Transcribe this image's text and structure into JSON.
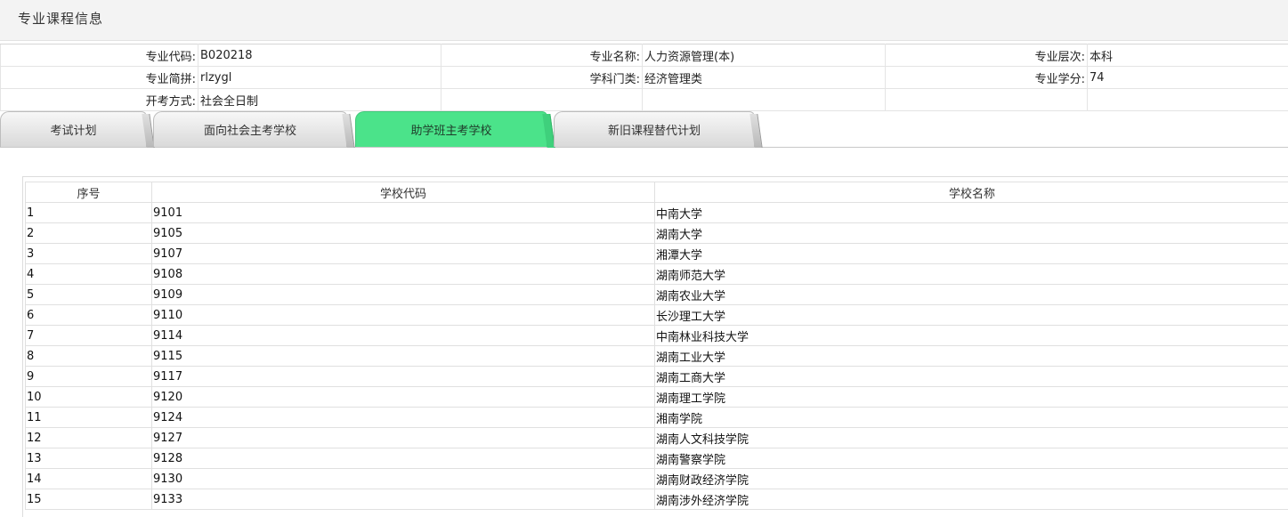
{
  "header": {
    "title": "专业课程信息"
  },
  "info": {
    "rows": [
      [
        {
          "label": "专业代码:",
          "value": "B020218"
        },
        {
          "label": "专业名称:",
          "value": "人力资源管理(本)"
        },
        {
          "label": "专业层次:",
          "value": "本科"
        }
      ],
      [
        {
          "label": "专业简拼:",
          "value": "rlzygl"
        },
        {
          "label": "学科门类:",
          "value": "经济管理类"
        },
        {
          "label": "专业学分:",
          "value": "74"
        }
      ],
      [
        {
          "label": "开考方式:",
          "value": "社会全日制"
        },
        {
          "label": "",
          "value": ""
        },
        {
          "label": "",
          "value": ""
        }
      ]
    ]
  },
  "tabs": [
    {
      "label": "考试计划",
      "active": false
    },
    {
      "label": "面向社会主考学校",
      "active": false
    },
    {
      "label": "助学班主考学校",
      "active": true
    },
    {
      "label": "新旧课程替代计划",
      "active": false
    }
  ],
  "colors": {
    "active_tab": "#4be38a",
    "header_bg": "#f3f3f3"
  },
  "schools": {
    "columns": [
      "序号",
      "学校代码",
      "学校名称"
    ],
    "rows": [
      [
        "1",
        "9101",
        "中南大学"
      ],
      [
        "2",
        "9105",
        "湖南大学"
      ],
      [
        "3",
        "9107",
        "湘潭大学"
      ],
      [
        "4",
        "9108",
        "湖南师范大学"
      ],
      [
        "5",
        "9109",
        "湖南农业大学"
      ],
      [
        "6",
        "9110",
        "长沙理工大学"
      ],
      [
        "7",
        "9114",
        "中南林业科技大学"
      ],
      [
        "8",
        "9115",
        "湖南工业大学"
      ],
      [
        "9",
        "9117",
        "湖南工商大学"
      ],
      [
        "10",
        "9120",
        "湖南理工学院"
      ],
      [
        "11",
        "9124",
        "湘南学院"
      ],
      [
        "12",
        "9127",
        "湖南人文科技学院"
      ],
      [
        "13",
        "9128",
        "湖南警察学院"
      ],
      [
        "14",
        "9130",
        "湖南财政经济学院"
      ],
      [
        "15",
        "9133",
        "湖南涉外经济学院"
      ]
    ]
  }
}
